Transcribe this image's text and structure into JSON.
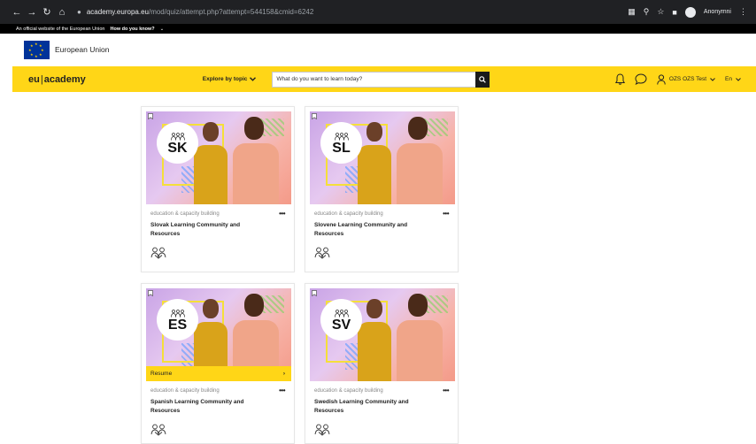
{
  "browser": {
    "url_host": "academy.europa.eu",
    "url_path": "/mod/quiz/attempt.php?attempt=544158&cmid=6242",
    "profile_label": "Anonymni"
  },
  "official_bar": {
    "text": "An official website of the European Union",
    "link": "How do you know?"
  },
  "eu_header": {
    "name": "European Union"
  },
  "nav": {
    "logo_left": "eu",
    "logo_right": "academy",
    "explore_label": "Explore by topic",
    "search_placeholder": "What do you want to learn today?",
    "user_label": "OZS OZS Test",
    "language": "En"
  },
  "cards": [
    {
      "code": "SK",
      "category": "education & capacity building",
      "title": "Slovak Learning Community and Resources"
    },
    {
      "code": "SL",
      "category": "education & capacity building",
      "title": "Slovene Learning Community and Resources"
    },
    {
      "code": "ES",
      "category": "education & capacity building",
      "title": "Spanish Learning Community and Resources",
      "resume_label": "Resume"
    },
    {
      "code": "SV",
      "category": "education & capacity building",
      "title": "Swedish Learning Community and Resources"
    }
  ],
  "colors": {
    "accent": "#ffd617",
    "eu_blue": "#003399",
    "chrome": "#202124"
  }
}
